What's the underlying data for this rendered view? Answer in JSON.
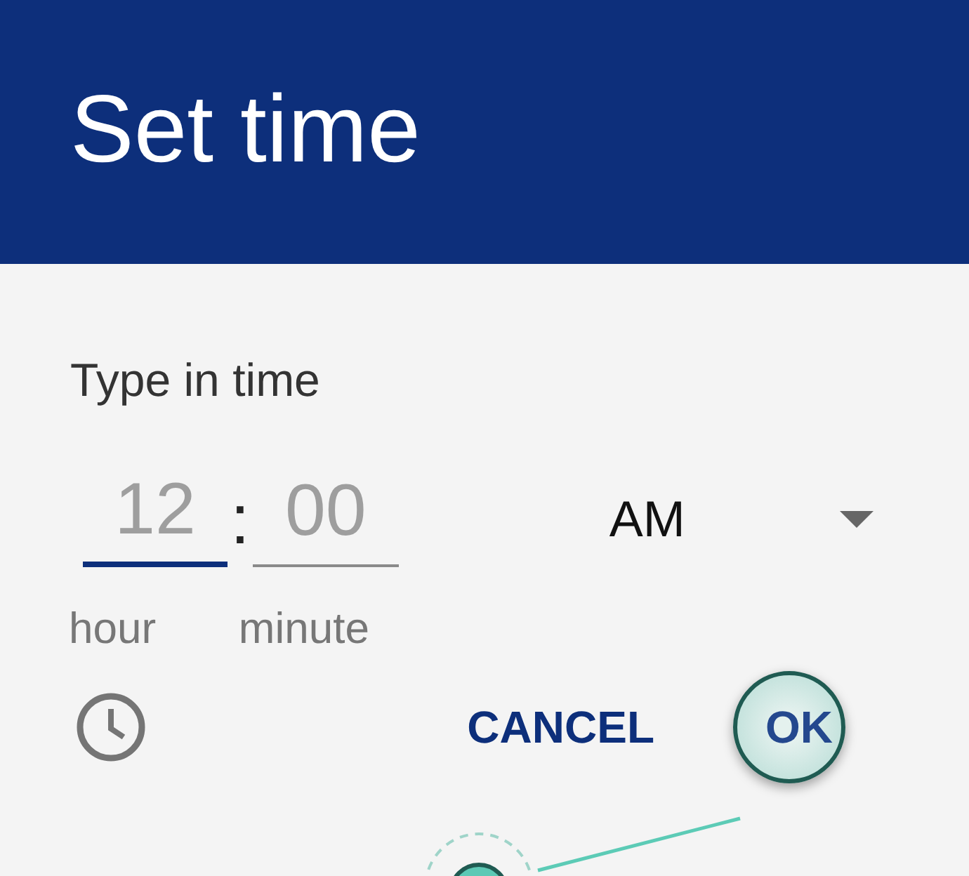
{
  "header": {
    "title": "Set time"
  },
  "body": {
    "heading": "Type in time",
    "hour": {
      "placeholder": "12",
      "focused": true,
      "caption": "hour"
    },
    "separator": ":",
    "minute": {
      "placeholder": "00",
      "focused": false,
      "caption": "minute"
    },
    "period": {
      "value": "AM"
    }
  },
  "buttons": [
    {
      "label": "CANCEL",
      "highlighted": false
    },
    {
      "label": "OK",
      "highlighted": true
    }
  ]
}
